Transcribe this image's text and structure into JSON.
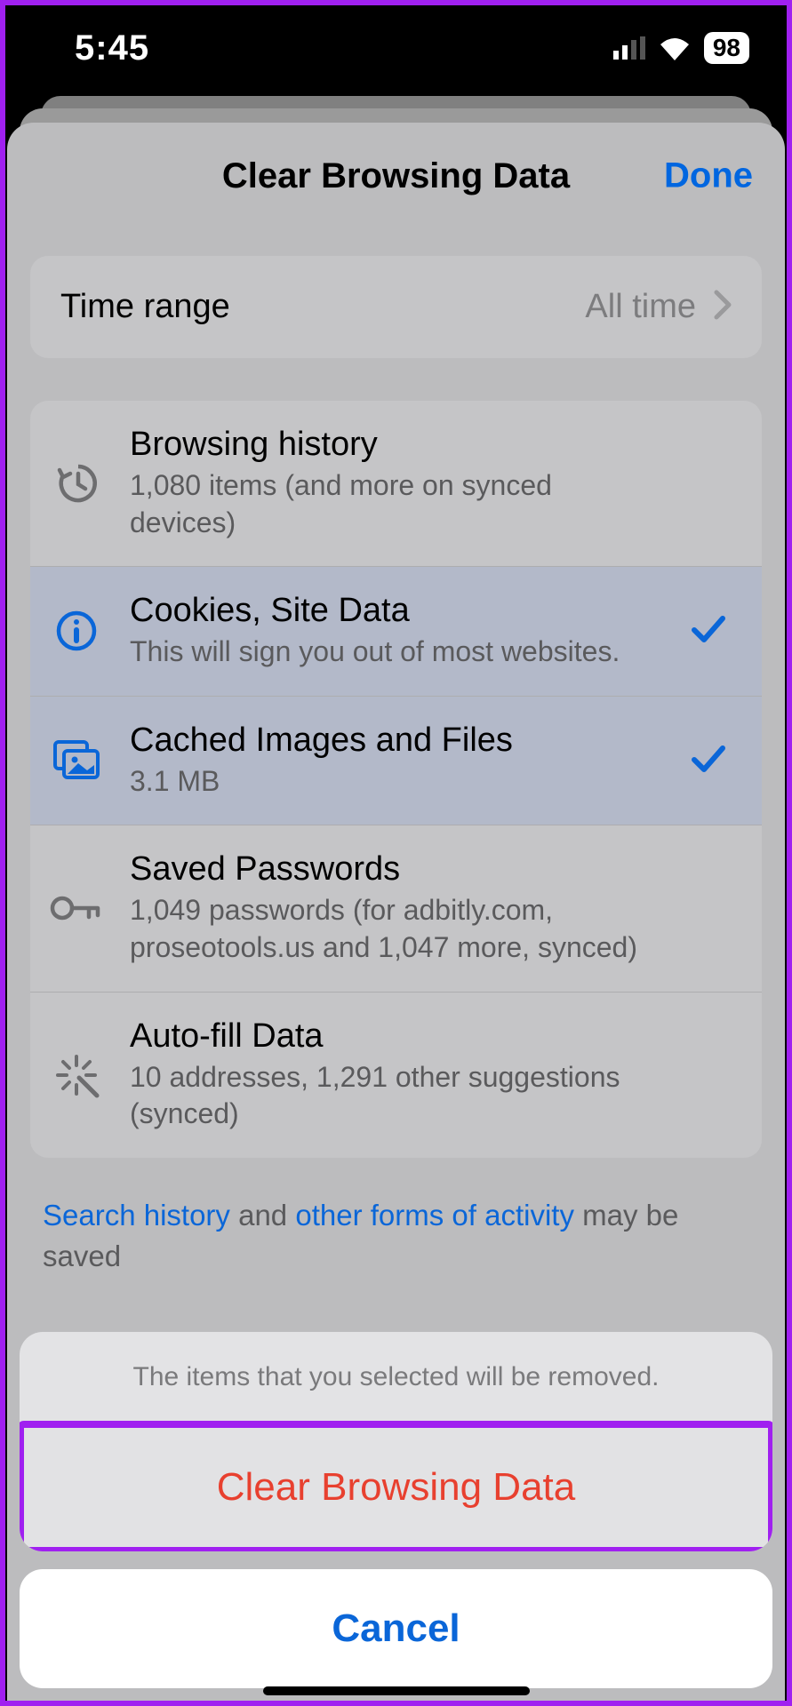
{
  "status_bar": {
    "time": "5:45",
    "battery": "98"
  },
  "sheet": {
    "title": "Clear Browsing Data",
    "done": "Done"
  },
  "time_range": {
    "label": "Time range",
    "value": "All time"
  },
  "items": [
    {
      "title": "Browsing history",
      "subtitle": "1,080 items (and more on synced devices)",
      "icon": "history",
      "selected": false
    },
    {
      "title": "Cookies, Site Data",
      "subtitle": "This will sign you out of most websites.",
      "icon": "info",
      "selected": true
    },
    {
      "title": "Cached Images and Files",
      "subtitle": "3.1 MB",
      "icon": "images",
      "selected": true
    },
    {
      "title": "Saved Passwords",
      "subtitle": "1,049 passwords (for adbitly.com, proseotools.us and 1,047 more, synced)",
      "icon": "key",
      "selected": false
    },
    {
      "title": "Auto-fill Data",
      "subtitle": "10 addresses, 1,291 other suggestions (synced)",
      "icon": "wand",
      "selected": false
    }
  ],
  "note": {
    "link1": "Search history",
    "mid": " and ",
    "link2": "other forms of activity",
    "tail": " may be saved"
  },
  "action_sheet": {
    "message": "The items that you selected will be removed.",
    "destructive": "Clear Browsing Data",
    "cancel": "Cancel"
  }
}
